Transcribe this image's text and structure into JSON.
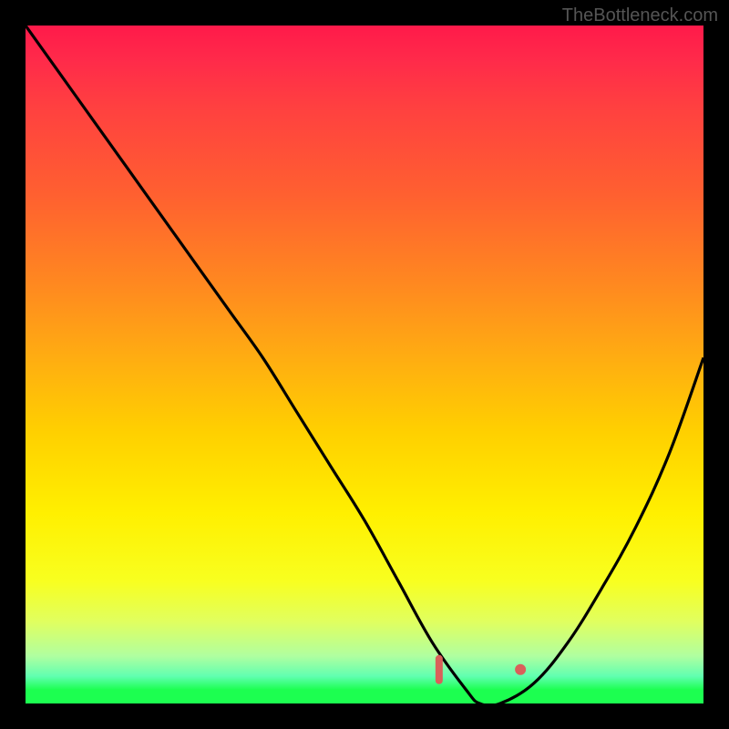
{
  "attribution": "TheBottleneck.com",
  "chart_data": {
    "type": "line",
    "title": "",
    "xlabel": "",
    "ylabel": "",
    "xlim": [
      0,
      100
    ],
    "ylim": [
      0,
      100
    ],
    "series": [
      {
        "name": "bottleneck-curve",
        "x": [
          0,
          5,
          10,
          15,
          20,
          25,
          30,
          35,
          40,
          45,
          50,
          55,
          60,
          65,
          67,
          70,
          75,
          80,
          85,
          90,
          95,
          100
        ],
        "y": [
          100,
          93,
          86,
          79,
          72,
          65,
          58,
          51,
          43,
          35,
          27,
          18,
          9,
          2,
          0,
          0,
          3,
          9,
          17,
          26,
          37,
          51
        ]
      }
    ],
    "markers": [
      {
        "name": "flat-zone-left",
        "x": 61,
        "y": 5,
        "shape": "bar"
      },
      {
        "name": "flat-zone-right",
        "x": 73,
        "y": 5,
        "shape": "dot"
      }
    ],
    "gradient_stops": [
      {
        "pos": 0,
        "color": "#ff1a4a"
      },
      {
        "pos": 50,
        "color": "#ffd000"
      },
      {
        "pos": 100,
        "color": "#1cff50"
      }
    ]
  }
}
